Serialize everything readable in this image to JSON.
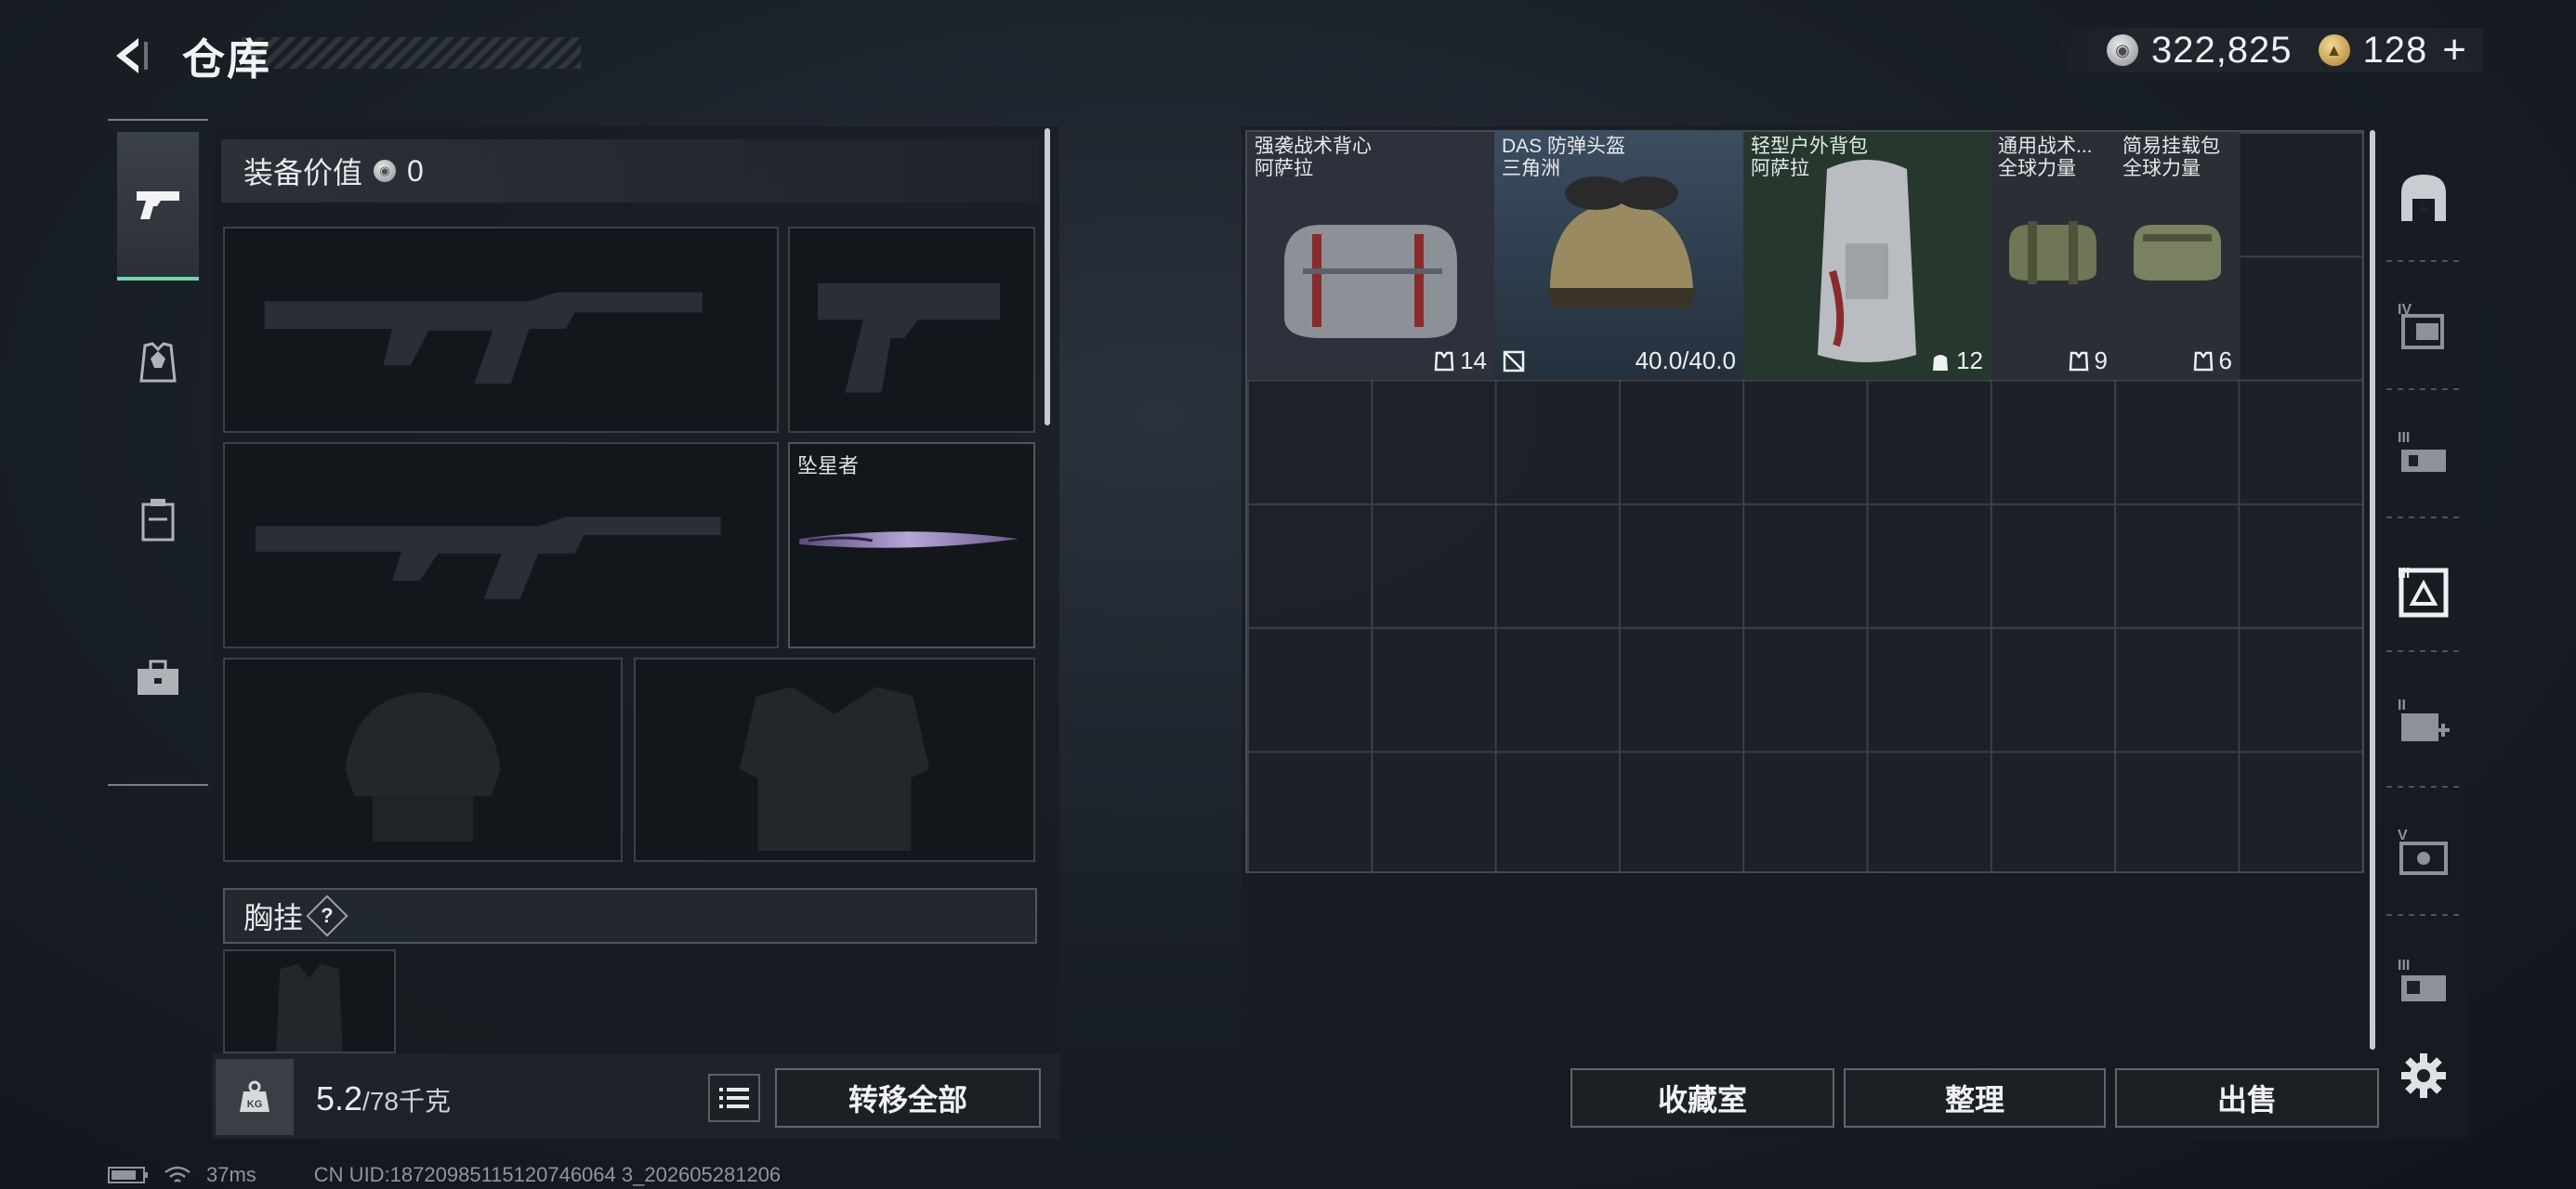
{
  "header": {
    "title": "仓库",
    "silver_amount": "322,825",
    "gold_amount": "128",
    "plus_symbol": "+"
  },
  "left_panel": {
    "equip_value_label": "装备价值",
    "equip_value": "0",
    "melee_name": "坠星者",
    "chest_rig_label": "胸挂",
    "help_symbol": "?",
    "weight_current": "5.2",
    "weight_max": "/78千克",
    "transfer_all_label": "转移全部"
  },
  "storage": {
    "items": [
      {
        "name_line1": "强袭战术背心",
        "name_line2": "阿萨拉",
        "badge": "14",
        "badge_icon": "vest-icon",
        "rarity_color": "#2c2e3a"
      },
      {
        "name_line1": "DAS 防弹头盔",
        "name_line2": "三角洲",
        "badge": "40.0/40.0",
        "badge_icon": "durability-icon",
        "rarity_color": "#2c3a4a"
      },
      {
        "name_line1": "轻型户外背包",
        "name_line2": "阿萨拉",
        "badge": "12",
        "badge_icon": "backpack-icon",
        "rarity_color": "#24362c"
      },
      {
        "name_line1": "通用战术...",
        "name_line2": "全球力量",
        "badge": "9",
        "badge_icon": "vest-icon",
        "rarity_color": "#2a2f35"
      },
      {
        "name_line1": "简易挂载包",
        "name_line2": "全球力量",
        "badge": "6",
        "badge_icon": "vest-icon",
        "rarity_color": "#2a2f35"
      }
    ],
    "buttons": {
      "collection": "收藏室",
      "sort": "整理",
      "sell": "出售"
    }
  },
  "status_bar": {
    "ping": "37ms",
    "uid": "CN UID:18720985115120746064 3_202605281206"
  }
}
